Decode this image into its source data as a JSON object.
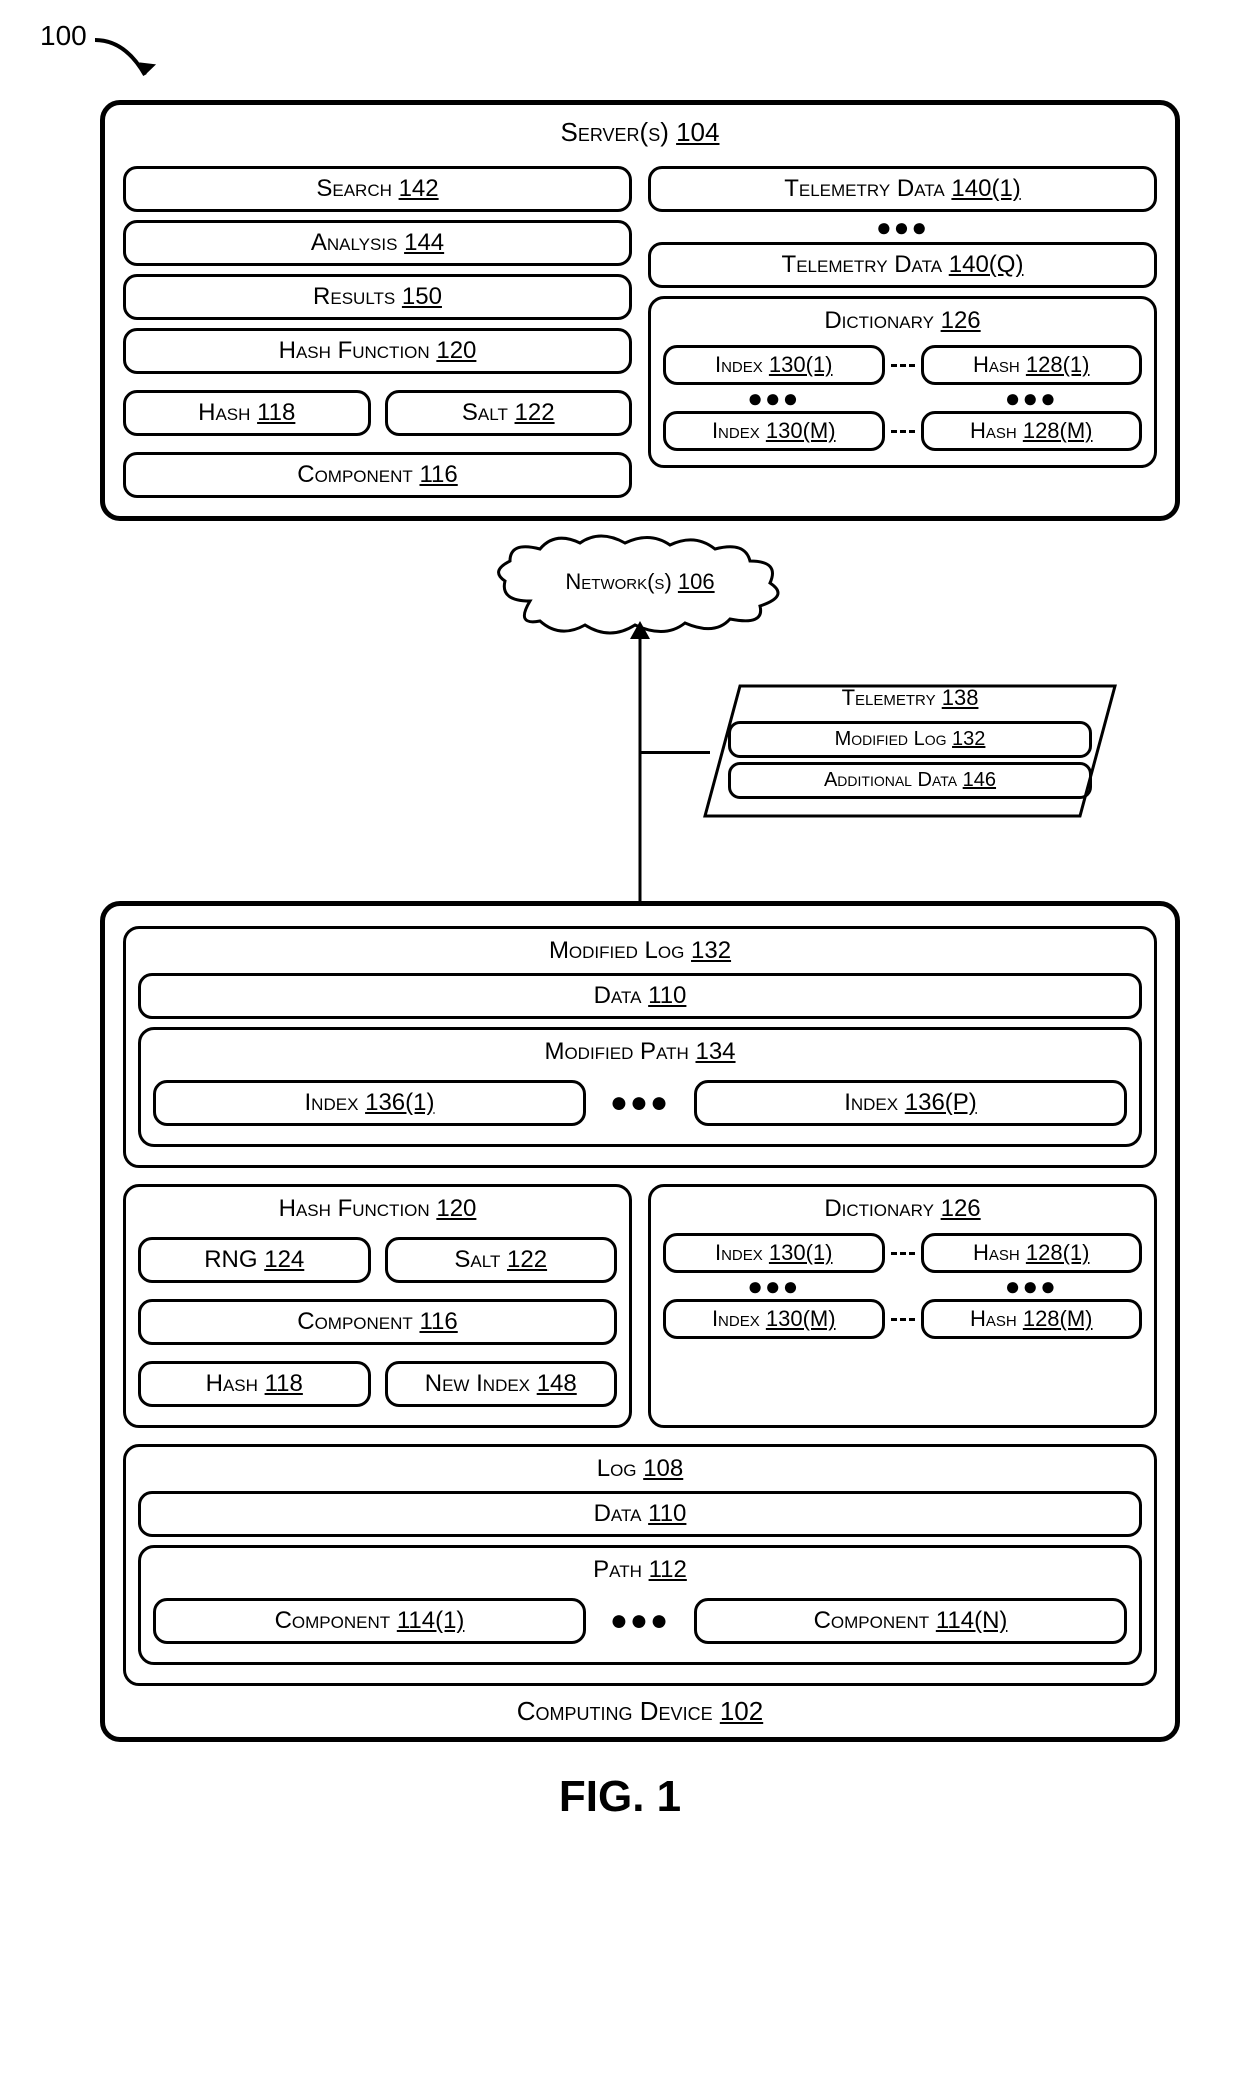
{
  "ref": "100",
  "server": {
    "title": "Server(s)",
    "num": "104",
    "left": [
      {
        "label": "Search",
        "num": "142"
      },
      {
        "label": "Analysis",
        "num": "144"
      },
      {
        "label": "Results",
        "num": "150"
      },
      {
        "label": "Hash Function",
        "num": "120"
      }
    ],
    "leftPair": [
      {
        "label": "Hash",
        "num": "118"
      },
      {
        "label": "Salt",
        "num": "122"
      }
    ],
    "leftBottom": {
      "label": "Component",
      "num": "116"
    },
    "telemetry": [
      {
        "label": "Telemetry Data",
        "num": "140(1)"
      },
      {
        "label": "Telemetry Data",
        "num": "140(Q)"
      }
    ],
    "dict": {
      "title": "Dictionary",
      "num": "126",
      "rows": [
        {
          "a": {
            "label": "Index",
            "num": "130(1)"
          },
          "b": {
            "label": "Hash",
            "num": "128(1)"
          }
        },
        {
          "a": {
            "label": "Index",
            "num": "130(M)"
          },
          "b": {
            "label": "Hash",
            "num": "128(M)"
          }
        }
      ]
    }
  },
  "network": {
    "label": "Network(s)",
    "num": "106"
  },
  "telemetryFlow": {
    "title": "Telemetry",
    "num": "138",
    "items": [
      {
        "label": "Modified Log",
        "num": "132"
      },
      {
        "label": "Additional Data",
        "num": "146"
      }
    ]
  },
  "device": {
    "bottom": {
      "label": "Computing Device",
      "num": "102"
    },
    "modLog": {
      "title": "Modified Log",
      "num": "132",
      "data": {
        "label": "Data",
        "num": "110"
      },
      "path": {
        "title": "Modified Path",
        "num": "134",
        "items": [
          {
            "label": "Index",
            "num": "136(1)"
          },
          {
            "label": "Index",
            "num": "136(P)"
          }
        ]
      }
    },
    "hash": {
      "title": "Hash Function",
      "num": "120",
      "pair1": [
        {
          "label": "RNG",
          "num": "124"
        },
        {
          "label": "Salt",
          "num": "122"
        }
      ],
      "mid": {
        "label": "Component",
        "num": "116"
      },
      "pair2": [
        {
          "label": "Hash",
          "num": "118"
        },
        {
          "label": "New Index",
          "num": "148"
        }
      ]
    },
    "dict": {
      "title": "Dictionary",
      "num": "126",
      "rows": [
        {
          "a": {
            "label": "Index",
            "num": "130(1)"
          },
          "b": {
            "label": "Hash",
            "num": "128(1)"
          }
        },
        {
          "a": {
            "label": "Index",
            "num": "130(M)"
          },
          "b": {
            "label": "Hash",
            "num": "128(M)"
          }
        }
      ]
    },
    "log": {
      "title": "Log",
      "num": "108",
      "data": {
        "label": "Data",
        "num": "110"
      },
      "path": {
        "title": "Path",
        "num": "112",
        "items": [
          {
            "label": "Component",
            "num": "114(1)"
          },
          {
            "label": "Component",
            "num": "114(N)"
          }
        ]
      }
    }
  },
  "figLabel": "FIG. 1"
}
